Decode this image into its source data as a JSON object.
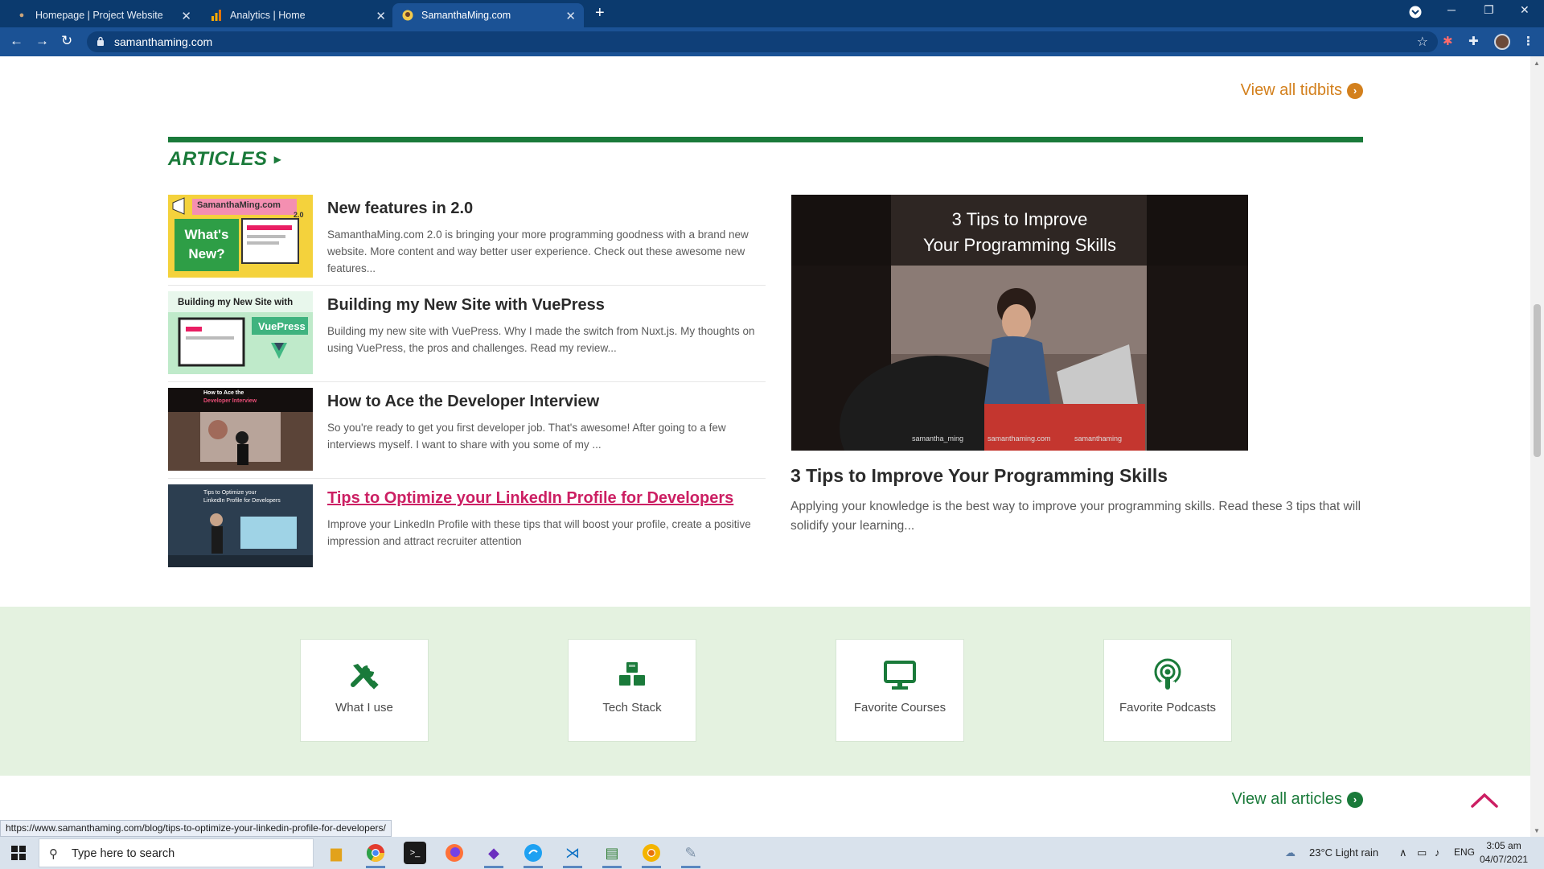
{
  "browser": {
    "tabs": [
      {
        "title": "Homepage | Project Website"
      },
      {
        "title": "Analytics | Home"
      },
      {
        "title": "SamanthaMing.com"
      }
    ],
    "url": "samanthaming.com",
    "status_url": "https://www.samanthaming.com/blog/tips-to-optimize-your-linkedin-profile-for-developers/"
  },
  "page": {
    "view_all_tidbits": "View all tidbits",
    "articles_heading": "ARTICLES",
    "articles": [
      {
        "title": "New features in 2.0",
        "desc": "SamanthaMing.com 2.0 is bringing your more programming goodness with a brand new website. More content and way better user experience. Check out these awesome new features...",
        "thumb_lines": [
          "SamanthaMing.com",
          "What's New?",
          "2.0"
        ]
      },
      {
        "title": "Building my New Site with VuePress",
        "desc": "Building my new site with VuePress. Why I made the switch from Nuxt.js. My thoughts on using VuePress, the pros and challenges. Read my review...",
        "thumb_lines": [
          "Building my New Site with",
          "VuePress"
        ]
      },
      {
        "title": "How to Ace the Developer Interview",
        "desc": "So you're ready to get you first developer job. That's awesome! After going to a few interviews myself. I want to share with you some of my ...",
        "thumb_lines": [
          "How to Ace the",
          "Developer Interview"
        ]
      },
      {
        "title": "Tips to Optimize your LinkedIn Profile for Developers",
        "desc": "Improve your LinkedIn Profile with these tips that will boost your profile, create a positive impression and attract recruiter attention",
        "thumb_lines": [
          "Tips to Optimize your",
          "LinkedIn Profile for Developers"
        ]
      }
    ],
    "feature": {
      "image_title_line1": "3 Tips to Improve",
      "image_title_line2": "Your Programming Skills",
      "image_footer": [
        "samantha_ming",
        "samanthaming.com",
        "samanthaming"
      ],
      "title": "3 Tips to Improve Your Programming Skills",
      "desc": "Applying your knowledge is the best way to improve your programming skills. Read these 3 tips that will solidify your learning..."
    },
    "resources": [
      {
        "label": "What I use",
        "icon": "tools-icon"
      },
      {
        "label": "Tech Stack",
        "icon": "cubes-icon"
      },
      {
        "label": "Favorite Courses",
        "icon": "desktop-icon"
      },
      {
        "label": "Favorite Podcasts",
        "icon": "podcast-icon"
      }
    ],
    "view_all_articles": "View all articles"
  },
  "taskbar": {
    "search_placeholder": "Type here to search",
    "weather": "23°C  Light rain",
    "language": "ENG",
    "time": "3:05 am",
    "date": "04/07/2021"
  },
  "colors": {
    "brand_green": "#1a7a3a",
    "accent_orange": "#d3801d",
    "link_hover_pink": "#cc1f63",
    "chrome_blue": "#0b3a6e"
  }
}
